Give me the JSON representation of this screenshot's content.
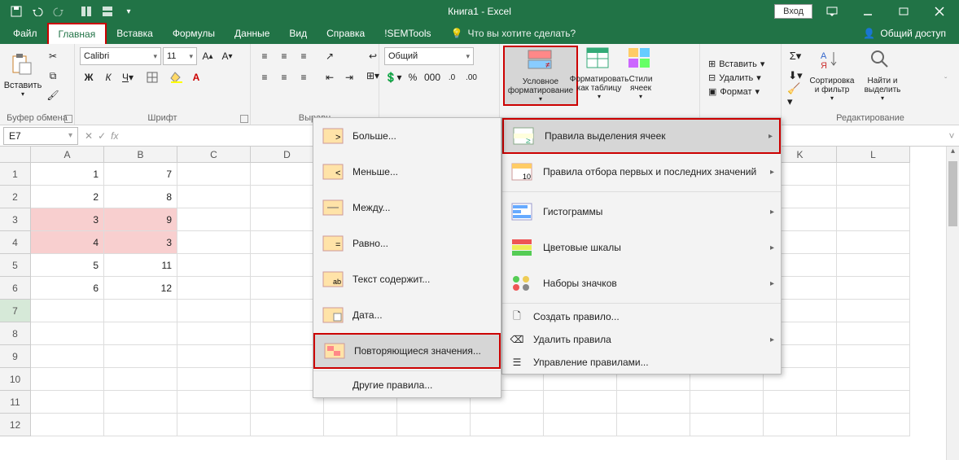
{
  "title": "Книга1 - Excel",
  "login": "Вход",
  "tabs": [
    "Файл",
    "Главная",
    "Вставка",
    "Формулы",
    "Данные",
    "Вид",
    "Справка",
    "!SEMTools"
  ],
  "active_tab": 1,
  "tell_me": "Что вы хотите сделать?",
  "share": "Общий доступ",
  "ribbon": {
    "clipboard": {
      "paste": "Вставить",
      "label": "Буфер обмена"
    },
    "font": {
      "name": "Calibri",
      "size": "11",
      "bold": "Ж",
      "italic": "К",
      "underline": "Ч",
      "label": "Шрифт"
    },
    "alignment": {
      "label": "Выравн"
    },
    "number": {
      "format": "Общий"
    },
    "styles": {
      "cond": "Условное форматирование",
      "as_table": "Форматировать как таблицу",
      "cell_styles": "Стили ячеек"
    },
    "cells": {
      "insert": "Вставить",
      "delete": "Удалить",
      "format": "Формат"
    },
    "editing": {
      "sort": "Сортировка и фильтр",
      "find": "Найти и выделить",
      "label": "Редактирование"
    }
  },
  "namebox": "E7",
  "columns": [
    "A",
    "B",
    "C",
    "D",
    "",
    "",
    "",
    "",
    "",
    "",
    "K",
    "L"
  ],
  "rows": [
    1,
    2,
    3,
    4,
    5,
    6,
    7,
    8,
    9,
    10,
    11,
    12
  ],
  "active_row": 7,
  "data": {
    "A": [
      1,
      2,
      3,
      4,
      5,
      6
    ],
    "B": [
      7,
      8,
      9,
      3,
      11,
      12
    ]
  },
  "pink_cells": [
    "A3",
    "B3",
    "A4",
    "B4"
  ],
  "menu_cond": {
    "highlight": "Правила выделения ячеек",
    "top": "Правила отбора первых и последних значений",
    "databars": "Гистограммы",
    "colorscales": "Цветовые шкалы",
    "iconsets": "Наборы значков",
    "new": "Создать правило...",
    "clear": "Удалить правила",
    "manage": "Управление правилами..."
  },
  "menu_highlight": {
    "greater": "Больше...",
    "less": "Меньше...",
    "between": "Между...",
    "equal": "Равно...",
    "text": "Текст содержит...",
    "date": "Дата...",
    "dup": "Повторяющиеся значения...",
    "other": "Другие правила..."
  }
}
